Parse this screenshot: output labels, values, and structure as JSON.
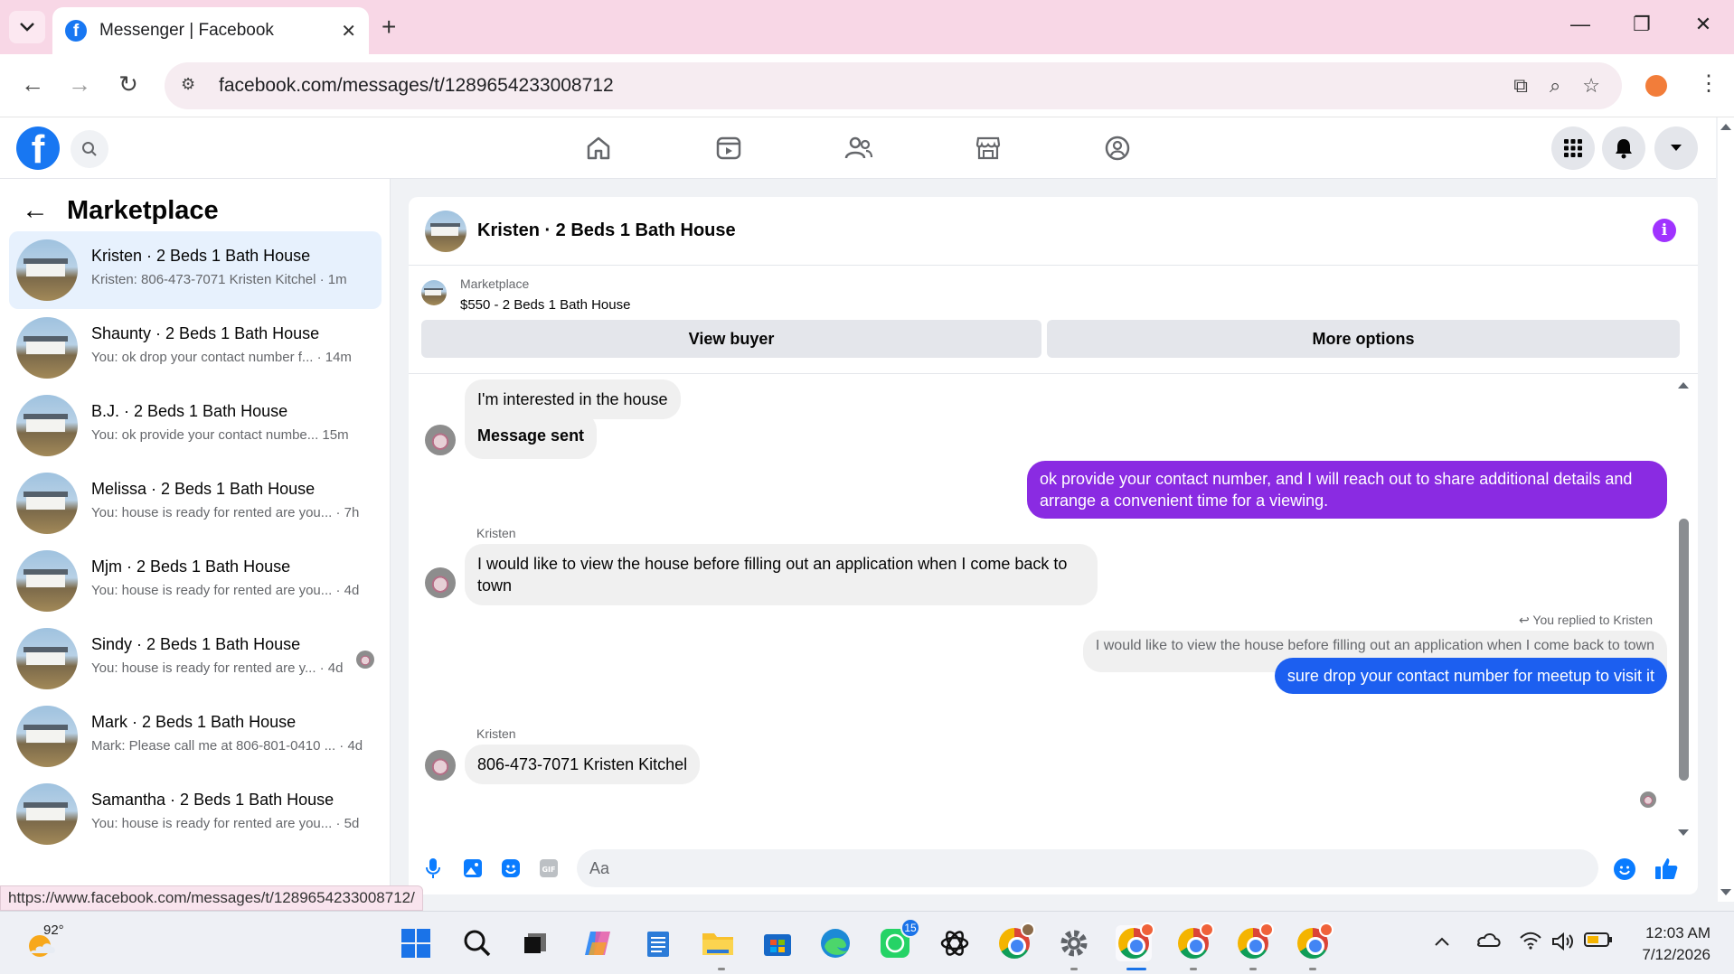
{
  "browser": {
    "tab_title": "Messenger | Facebook",
    "url": "facebook.com/messages/t/1289654233008712",
    "status_url": "https://www.facebook.com/messages/t/1289654233008712/"
  },
  "sidebar": {
    "title": "Marketplace",
    "conversations": [
      {
        "name": "Kristen · 2 Beds 1 Bath House",
        "snippet": "Kristen: 806-473-7071 Kristen Kitchel · 1m"
      },
      {
        "name": "Shaunty · 2 Beds 1 Bath House",
        "snippet": "You: ok drop your contact number f... · 14m"
      },
      {
        "name": "B.J. · 2 Beds 1 Bath House",
        "snippet": "You: ok provide your contact numbe... 15m"
      },
      {
        "name": "Melissa · 2 Beds 1 Bath House",
        "snippet": "You: house is ready for rented are you... · 7h"
      },
      {
        "name": "Mjm · 2 Beds 1 Bath House",
        "snippet": "You: house is ready for rented are you... · 4d"
      },
      {
        "name": "Sindy · 2 Beds 1 Bath House",
        "snippet": "You: house is ready for rented are y... · 4d"
      },
      {
        "name": "Mark · 2 Beds 1 Bath House",
        "snippet": "Mark: Please call me at 806-801-0410 ... · 4d"
      },
      {
        "name": "Samantha · 2 Beds 1 Bath House",
        "snippet": "You: house is ready for rented are you... · 5d"
      }
    ]
  },
  "chat": {
    "title": "Kristen · 2 Beds 1 Bath House",
    "marketplace_label": "Marketplace",
    "listing": "$550 - 2 Beds 1 Bath House",
    "view_buyer": "View buyer",
    "more_options": "More options",
    "msg1": "I'm interested in the house",
    "msg2": "Message sent",
    "out1": "ok provide your contact number, and I will reach out to share additional details and arrange a convenient time for a viewing.",
    "sender": "Kristen",
    "msg3": "I would like to view the house before filling out an application when I come back to town",
    "reply_note": "You replied to Kristen",
    "quoted": "I would like to view the house before filling out an application when I come back to town",
    "out2": "sure drop your contact number for meetup to visit it",
    "msg4": "806-473-7071 Kristen Kitchel",
    "composer_placeholder": "Aa"
  },
  "taskbar": {
    "weather": "92°",
    "whatsapp_badge": "15",
    "time": "12:03 AM",
    "date": "7/12/2026"
  },
  "colors": {
    "facebook_blue": "#1877f2",
    "outgoing_purple": "#8a2be2",
    "outgoing_blue": "#1c5ff0",
    "tabbar_pink": "#f8d7e6"
  }
}
